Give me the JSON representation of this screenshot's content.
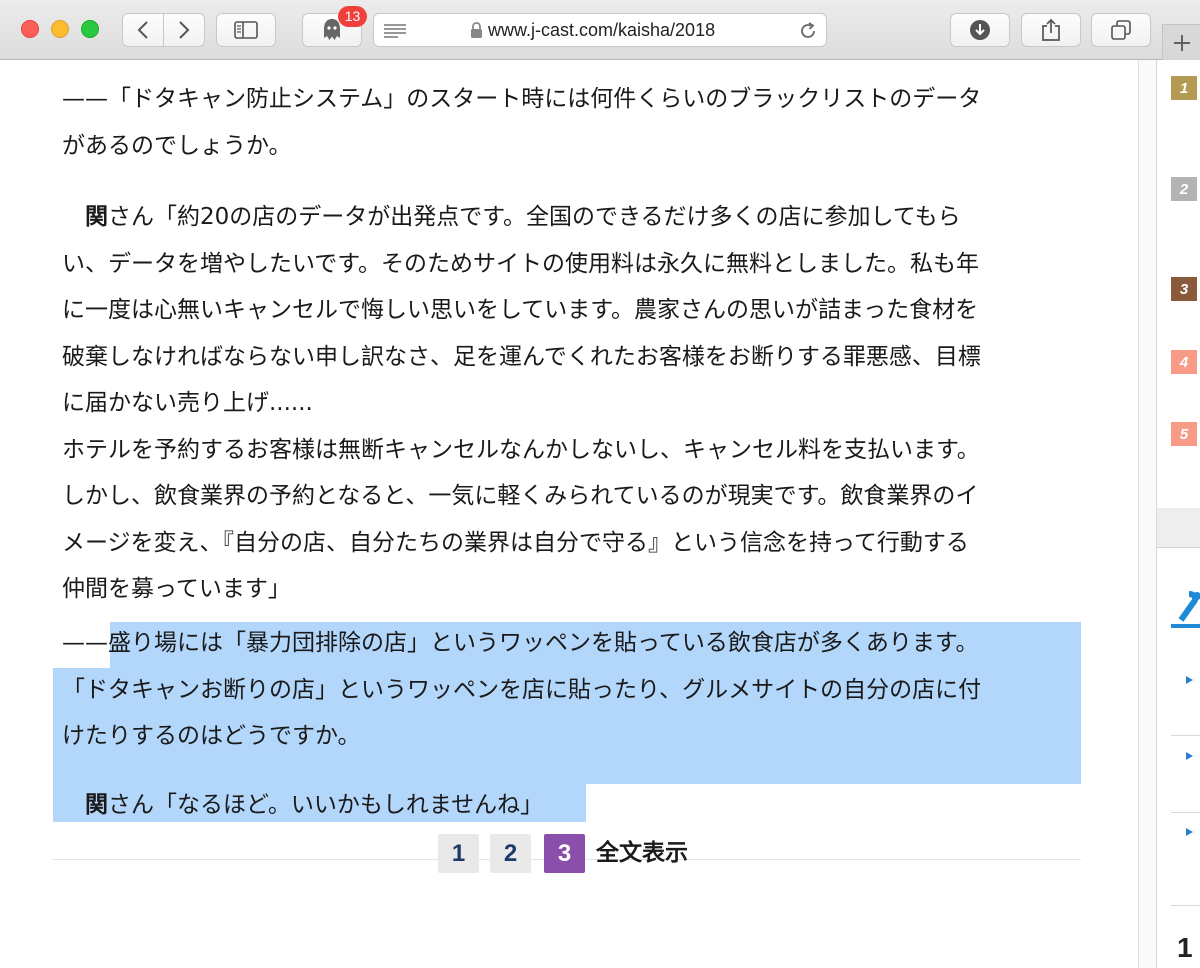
{
  "browser": {
    "badge_count": "13",
    "url": "www.j-cast.com/kaisha/2018"
  },
  "article": {
    "q1_lines": [
      "——「ドタキャン防止システム」のスタート時には何件くらいのブラックリストのデータ",
      "があるのでしょうか。"
    ],
    "a1_speaker": "関",
    "a1_lines": [
      "さん「約20の店のデータが出発点です。全国のできるだけ多くの店に参加してもら",
      "い、データを増やしたいです。そのためサイトの使用料は永久に無料としました。私も年",
      "に一度は心無いキャンセルで悔しい思いをしています。農家さんの思いが詰まった食材を",
      "破棄しなければならない申し訳なさ、足を運んでくれたお客様をお断りする罪悪感、目標",
      "に届かない売り上げ......",
      "ホテルを予約するお客様は無断キャンセルなんかしないし、キャンセル料を支払います。",
      "しかし、飲食業界の予約となると、一気に軽くみられているのが現実です。飲食業界のイ",
      "メージを変え、『自分の店、自分たちの業界は自分で守る』という信念を持って行動する",
      "仲間を募っています」"
    ],
    "q2_lines": [
      "——盛り場には「暴力団排除の店」というワッペンを貼っている飲食店が多くあります。",
      "「ドタキャンお断りの店」というワッペンを店に貼ったり、グルメサイトの自分の店に付",
      "けたりするのはどうですか。"
    ],
    "a2_speaker": "関",
    "a2_text": "さん「なるほど。いいかもしれませんね」"
  },
  "pagination": {
    "pages": [
      "1",
      "2",
      "3"
    ],
    "current": "3",
    "full_text": "全文表示"
  },
  "ranking": {
    "numbers": [
      "1",
      "2",
      "3",
      "4",
      "5"
    ],
    "colors": [
      "#b39a52",
      "#b3b3b3",
      "#8b5a3c",
      "#f79b86",
      "#f79b86"
    ],
    "bottom_digit": "1"
  },
  "colors": {
    "selection": "#b3d6fb",
    "current_page": "#8a4fab",
    "page_digit": "#1e3a6a"
  }
}
